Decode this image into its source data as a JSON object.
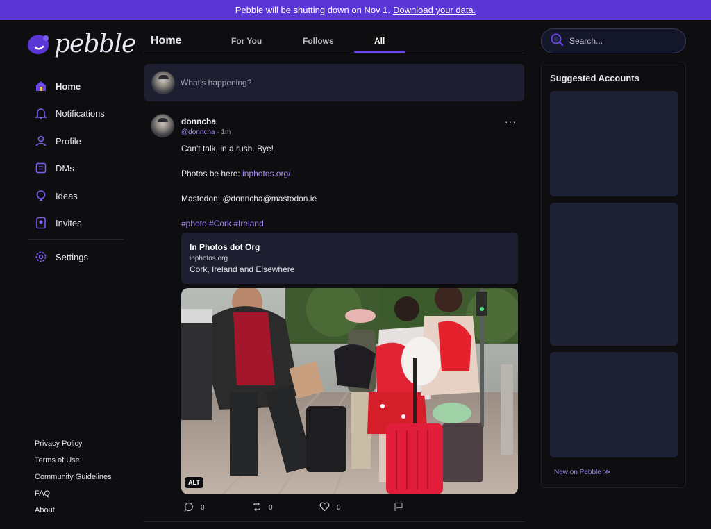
{
  "banner": {
    "text": "Pebble will be shutting down on Nov 1.",
    "link": "Download your data."
  },
  "brand": {
    "name": "pebble",
    "accent": "#5b36d6"
  },
  "nav": {
    "items": [
      {
        "label": "Home",
        "icon": "home-icon"
      },
      {
        "label": "Notifications",
        "icon": "bell-icon"
      },
      {
        "label": "Profile",
        "icon": "user-icon"
      },
      {
        "label": "DMs",
        "icon": "message-icon"
      },
      {
        "label": "Ideas",
        "icon": "lightbulb-icon"
      },
      {
        "label": "Invites",
        "icon": "invite-icon"
      },
      {
        "label": "Settings",
        "icon": "gear-icon"
      }
    ]
  },
  "footer": {
    "links": [
      "Privacy Policy",
      "Terms of Use",
      "Community Guidelines",
      "FAQ",
      "About"
    ]
  },
  "feed": {
    "title": "Home",
    "tabs": [
      "For You",
      "Follows",
      "All"
    ],
    "active_tab": "All",
    "compose_placeholder": "What's happening?"
  },
  "post": {
    "author": "donncha",
    "handle": "@donncha",
    "time": "1m",
    "menu": "···",
    "line1": "Can't talk, in a rush. Bye!",
    "photos_label": "Photos be here:",
    "photos_link": "inphotos.org/",
    "mastodon": "Mastodon: @donncha@mastodon.ie",
    "hashtags": "#photo #Cork #Ireland",
    "link_card": {
      "title": "In Photos dot Org",
      "domain": "inphotos.org",
      "description": "Cork, Ireland and Elsewhere"
    },
    "alt_badge": "ALT",
    "actions": {
      "replies": "0",
      "reposts": "0",
      "likes": "0"
    }
  },
  "right": {
    "search_placeholder": "Search...",
    "suggested_title": "Suggested Accounts",
    "new_link": "New on Pebble ≫"
  }
}
